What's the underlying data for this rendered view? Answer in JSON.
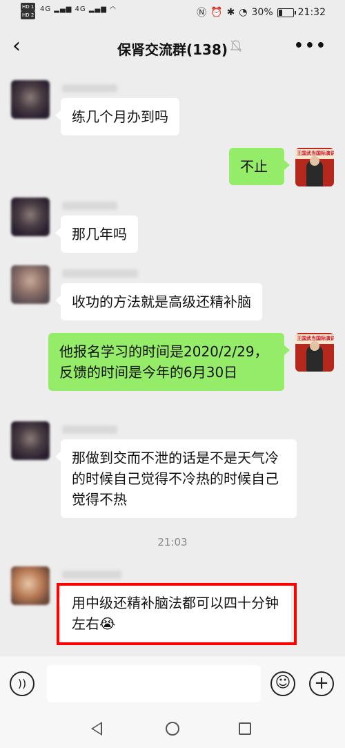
{
  "status_bar": {
    "sim1": "HD 1",
    "sim2": "HD 2",
    "network": "4G",
    "battery_percent": "30%",
    "battery_level": 0.3,
    "time": "21:32"
  },
  "header": {
    "title": "保肾交流群(138)",
    "back_icon": "chevron-left-icon",
    "mute_icon": "bell-off-icon",
    "more_icon": "more-icon"
  },
  "messages": [
    {
      "sender": "other",
      "text": "练几个月办到吗"
    },
    {
      "sender": "self",
      "text": "不止"
    },
    {
      "sender": "other",
      "text": "那几年吗"
    },
    {
      "sender": "other",
      "text": "收功的方法就是高级还精补脑"
    },
    {
      "sender": "self",
      "text": "他报名学习的时间是2020/2/29，反馈的时间是今年的6月30日"
    },
    {
      "sender": "other",
      "text": "那做到交而不泄的话是不是天气冷的时候自己觉得不冷热的时候自己觉得不热"
    },
    {
      "sender": "other",
      "text": "用中级还精补脑法都可以四十分钟左右😭"
    }
  ],
  "timestamp": "21:03",
  "self_avatar_text": "王国武当国际演讲",
  "input_bar": {
    "voice_icon": "voice-icon",
    "emoji_icon": "emoji-icon",
    "plus_icon": "plus-icon",
    "emoji_glyph": "☺",
    "plus_glyph": "+",
    "voice_glyph": "))"
  },
  "colors": {
    "background": "#ededed",
    "self_bubble": "#95ec69",
    "other_bubble": "#ffffff",
    "highlight": "#ff0000"
  }
}
